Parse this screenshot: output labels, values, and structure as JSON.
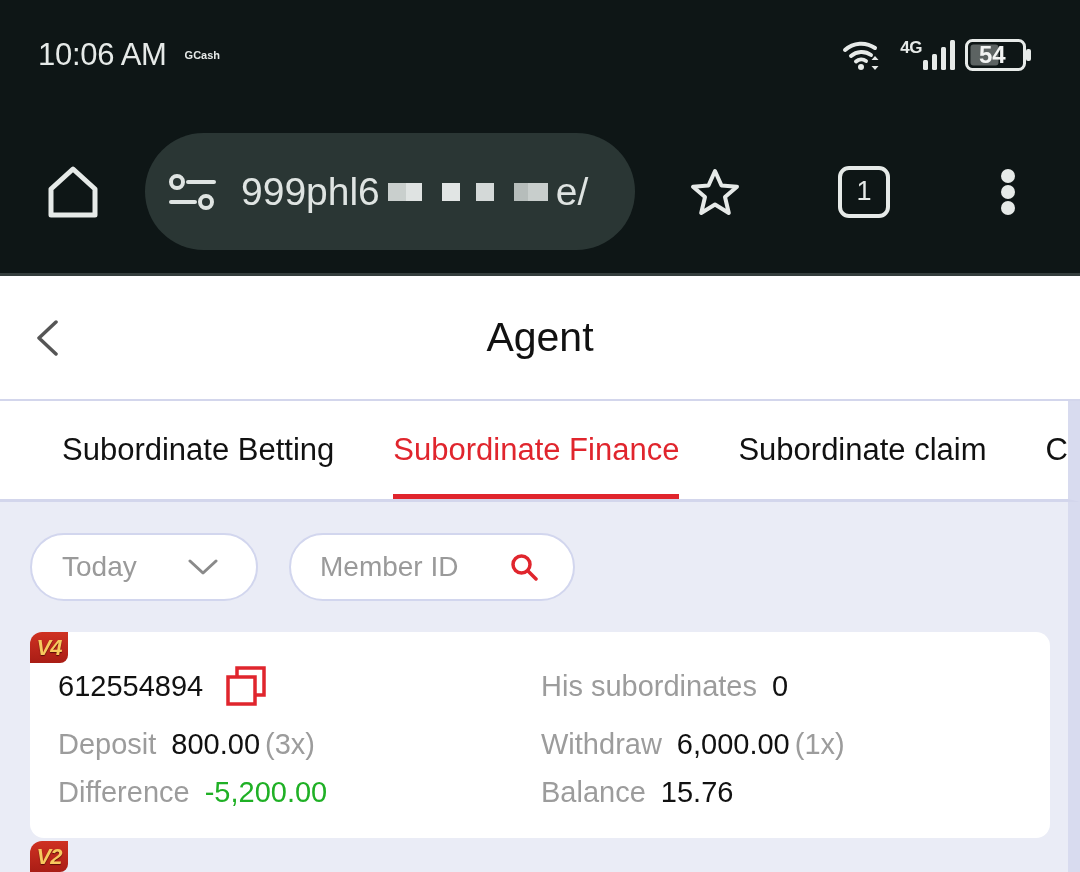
{
  "status_bar": {
    "time": "10:06 AM",
    "notification": "GCash",
    "network": "4G",
    "battery": "54"
  },
  "browser_toolbar": {
    "url_start": "999phl6",
    "url_end": "e/",
    "tab_count": "1"
  },
  "header": {
    "title": "Agent"
  },
  "tabs": [
    {
      "label": "Subordinate Betting",
      "selected": false
    },
    {
      "label": "Subordinate Finance",
      "selected": true
    },
    {
      "label": "Subordinate claim",
      "selected": false
    },
    {
      "label": "C",
      "selected": false
    }
  ],
  "filters": {
    "period": {
      "value": "Today"
    },
    "member_search": {
      "placeholder": "Member ID"
    }
  },
  "members": [
    {
      "level": "V4",
      "member_id": "612554894",
      "stats": [
        {
          "label": "His subordinates",
          "value": "0"
        },
        {
          "label": "Deposit",
          "value": "800.00",
          "count": "(3x)"
        },
        {
          "label": "Withdraw",
          "value": "6,000.00",
          "count": "(1x)"
        },
        {
          "label": "Difference",
          "value": "-5,200.00",
          "color": "#1fb025"
        },
        {
          "label": "Balance",
          "value": "15.76"
        }
      ]
    },
    {
      "level": "V2"
    }
  ]
}
